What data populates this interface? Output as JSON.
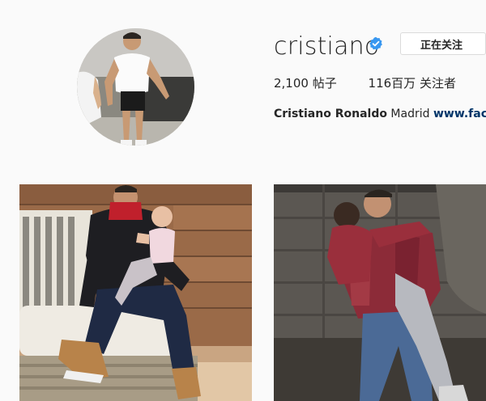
{
  "profile": {
    "username": "cristiano",
    "follow_button_label": "正在关注",
    "verified_icon": "verified-badge-icon",
    "stats": {
      "posts_count": "2,100",
      "posts_label": "帖子",
      "followers_count": "116百万",
      "followers_label": "关注者"
    },
    "bio": {
      "full_name": "Cristiano Ronaldo",
      "location": "Madrid",
      "link": "www.facebook.com/cristiano"
    }
  },
  "colors": {
    "verified_blue": "#3897f0",
    "text": "#262626",
    "link": "#003569"
  },
  "posts": [
    {
      "name": "post-ronaldo-with-baby-on-sofa"
    },
    {
      "name": "post-ronaldo-hugging-son"
    }
  ]
}
